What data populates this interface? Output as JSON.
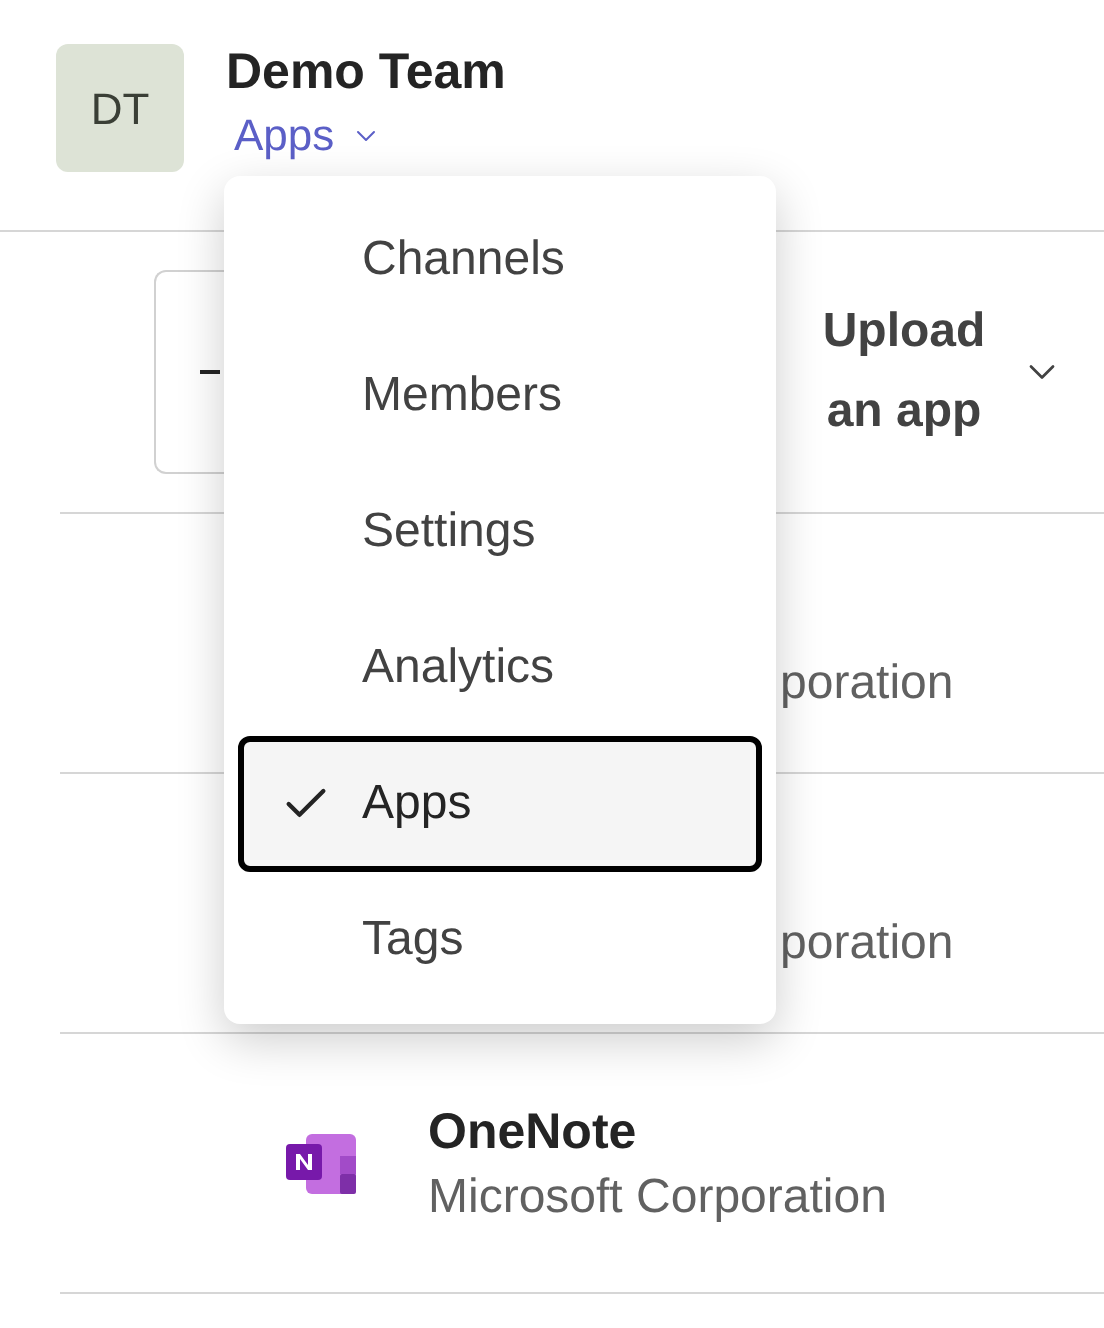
{
  "team": {
    "initials": "DT",
    "name": "Demo Team",
    "section": "Apps"
  },
  "toolbar": {
    "upload_button": "Upload an app"
  },
  "apps": [
    {
      "publisher": "poration"
    },
    {
      "publisher": "poration"
    },
    {
      "kind": "onenote",
      "name": "OneNote",
      "publisher": "Microsoft Corporation"
    }
  ],
  "menu": [
    {
      "label": "Channels",
      "selected": false
    },
    {
      "label": "Members",
      "selected": false
    },
    {
      "label": "Settings",
      "selected": false
    },
    {
      "label": "Analytics",
      "selected": false
    },
    {
      "label": "Apps",
      "selected": true
    },
    {
      "label": "Tags",
      "selected": false
    }
  ]
}
